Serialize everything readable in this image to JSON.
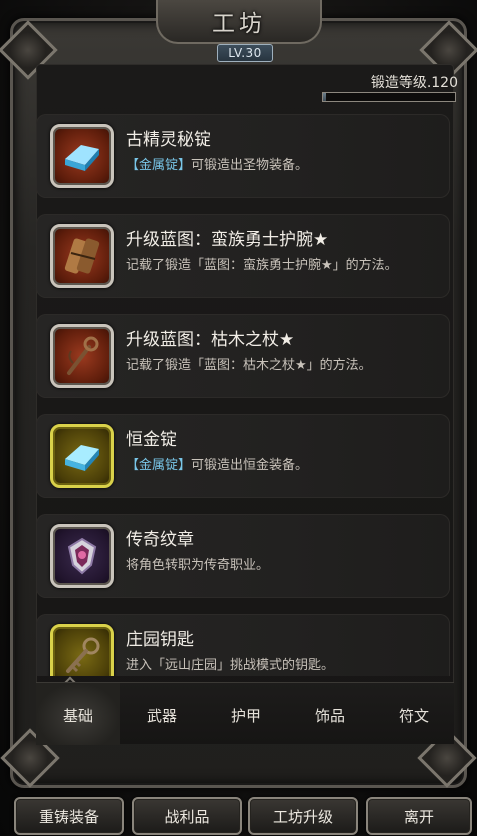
{
  "header": {
    "title": "工坊",
    "level": "LV.30"
  },
  "forge": {
    "label": "锻造等级.120",
    "progress": 0.02
  },
  "items": [
    {
      "name": "古精灵秘锭",
      "desc_prefix": "【金属锭】",
      "desc": "可锻造出圣物装备。",
      "icon": "blue-ingot-icon",
      "frame": "red"
    },
    {
      "name": "升级蓝图：蛮族勇士护腕★",
      "desc_prefix": "",
      "desc": "记载了锻造「蓝图：蛮族勇士护腕★」的方法。",
      "icon": "bracer-blueprint-icon",
      "frame": "red"
    },
    {
      "name": "升级蓝图：枯木之杖★",
      "desc_prefix": "",
      "desc": "记载了锻造「蓝图：枯木之杖★」的方法。",
      "icon": "staff-blueprint-icon",
      "frame": "red"
    },
    {
      "name": "恒金锭",
      "desc_prefix": "【金属锭】",
      "desc": "可锻造出恒金装备。",
      "icon": "blue-ingot-icon",
      "frame": "gold"
    },
    {
      "name": "传奇纹章",
      "desc_prefix": "",
      "desc": "将角色转职为传奇职业。",
      "icon": "emblem-icon",
      "frame": "purple"
    },
    {
      "name": "庄园钥匙",
      "desc_prefix": "",
      "desc": "进入「远山庄园」挑战模式的钥匙。",
      "icon": "key-icon",
      "frame": "gold"
    }
  ],
  "tabs": [
    "基础",
    "武器",
    "护甲",
    "饰品",
    "符文"
  ],
  "active_tab": "基础",
  "bottom_buttons": [
    "重铸装备",
    "战利品",
    "工坊升级",
    "离开"
  ]
}
